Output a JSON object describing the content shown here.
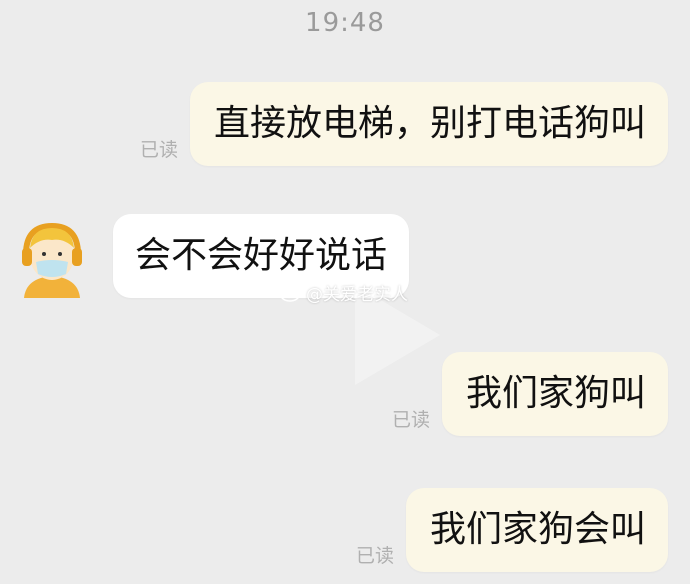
{
  "timestamp": "19:48",
  "messages": [
    {
      "side": "outgoing",
      "text": "直接放电梯，别打电话狗叫",
      "status": "已读"
    },
    {
      "side": "incoming",
      "text": "会不会好好说话"
    },
    {
      "side": "outgoing",
      "text": "我们家狗叫",
      "status": "已读"
    },
    {
      "side": "outgoing",
      "text": "我们家狗会叫",
      "status": "已读"
    }
  ],
  "watermark": {
    "text": "@关爱老实人",
    "icon": "weibo-icon"
  },
  "colors": {
    "background": "#ececec",
    "outgoing_bubble": "#fbf7e6",
    "incoming_bubble": "#ffffff",
    "read_status": "#b0b0b0",
    "timestamp": "#9a9a9a"
  }
}
